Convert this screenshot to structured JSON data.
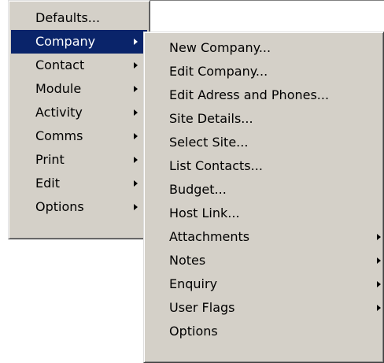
{
  "main_menu": {
    "items": [
      {
        "label": "Defaults...",
        "submenu": false
      },
      {
        "label": "Company",
        "submenu": true,
        "selected": true
      },
      {
        "label": "Contact",
        "submenu": true
      },
      {
        "label": "Module",
        "submenu": true
      },
      {
        "label": "Activity",
        "submenu": true
      },
      {
        "label": "Comms",
        "submenu": true
      },
      {
        "label": "Print",
        "submenu": true
      },
      {
        "label": "Edit",
        "submenu": true
      },
      {
        "label": "Options",
        "submenu": true
      }
    ]
  },
  "company_submenu": {
    "items": [
      {
        "label": "New Company...",
        "submenu": false
      },
      {
        "label": "Edit Company...",
        "submenu": false
      },
      {
        "label": "Edit Adress and Phones...",
        "submenu": false
      },
      {
        "label": "Site Details...",
        "submenu": false
      },
      {
        "label": "Select Site...",
        "submenu": false
      },
      {
        "label": "List Contacts...",
        "submenu": false
      },
      {
        "label": "Budget...",
        "submenu": false
      },
      {
        "label": "Host Link...",
        "submenu": false
      },
      {
        "label": "Attachments",
        "submenu": true
      },
      {
        "label": "Notes",
        "submenu": true
      },
      {
        "label": "Enquiry",
        "submenu": true
      },
      {
        "label": "User Flags",
        "submenu": true
      },
      {
        "label": "Options",
        "submenu": false
      }
    ]
  },
  "colors": {
    "menu_background": "#d4d0c8",
    "selection_background": "#0a246a",
    "selection_text": "#ffffff"
  },
  "icons": {
    "submenu_indicator": "submenu-arrow-icon"
  }
}
